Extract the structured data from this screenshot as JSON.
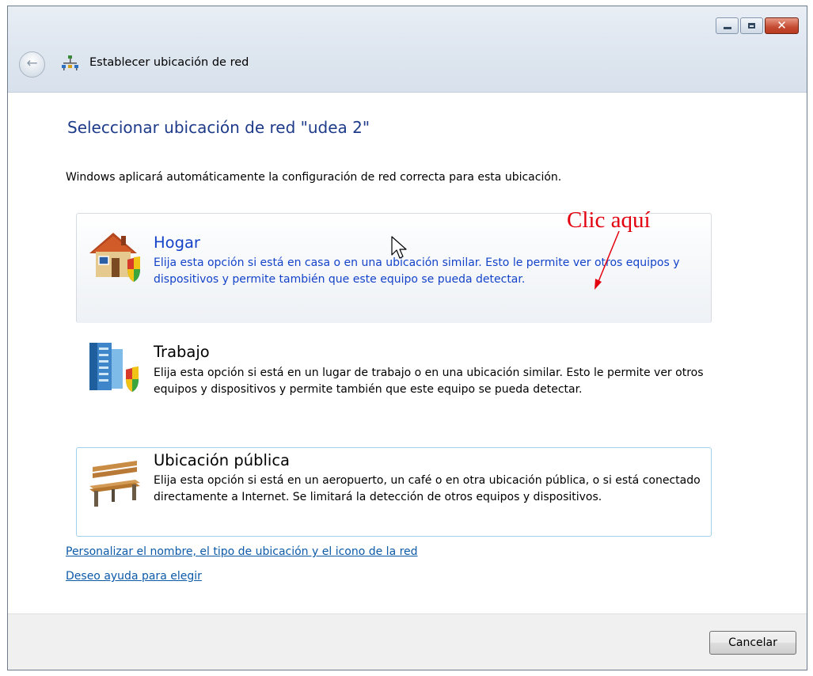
{
  "window": {
    "title": "Establecer ubicación de red"
  },
  "heading": "Seleccionar ubicación de red \"udea  2\"",
  "intro": "Windows aplicará automáticamente la configuración de red correcta para esta ubicación.",
  "options": [
    {
      "title": "Hogar",
      "icon": "house-icon",
      "description": "Elija esta opción si está en casa o en una ubicación similar. Esto le permite ver otros equipos y dispositivos y permite también que este equipo se pueda detectar."
    },
    {
      "title": "Trabajo",
      "icon": "office-building-icon",
      "description": "Elija esta opción si está en un lugar de trabajo o en una ubicación similar. Esto le permite ver otros equipos y dispositivos y permite también que este equipo se pueda detectar."
    },
    {
      "title": "Ubicación pública",
      "icon": "park-bench-icon",
      "description": "Elija esta opción si está en un aeropuerto, un café o en otra ubicación pública, o si está conectado directamente a Internet. Se limitará la detección de otros equipos y dispositivos."
    }
  ],
  "links": {
    "customize": "Personalizar el nombre, el tipo de ubicación y el icono de la red",
    "help": "Deseo ayuda para elegir"
  },
  "footer": {
    "cancel_label": "Cancelar"
  },
  "annotation": {
    "text": "Clic aquí",
    "color": "#e3000f"
  },
  "colors": {
    "heading": "#1e3b8a",
    "hover_text": "#1443c9",
    "link": "#0c5aa8",
    "selected_border": "#9fd1ec"
  }
}
